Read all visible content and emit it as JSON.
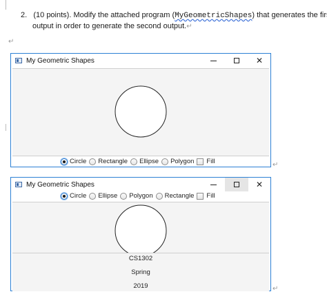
{
  "question": {
    "number": "2.",
    "line1_before": "(10 points). Modify the attached program (",
    "program_name": "MyGeometricShapes",
    "line1_after": ") that generates the first",
    "line2": "output in order to generate the second output.",
    "para_mark": "↵"
  },
  "window1": {
    "title": "My Geometric Shapes",
    "controls": {
      "minimize": "—",
      "maximize": "☐",
      "close": "✕"
    },
    "radios": [
      {
        "label": "Circle",
        "selected": true
      },
      {
        "label": "Rectangle",
        "selected": false
      },
      {
        "label": "Ellipse",
        "selected": false
      },
      {
        "label": "Polygon",
        "selected": false
      }
    ],
    "checkbox": {
      "label": "Fill",
      "checked": false
    }
  },
  "window2": {
    "title": "My Geometric Shapes",
    "controls": {
      "minimize": "—",
      "maximize": "☐",
      "close": "✕"
    },
    "radios": [
      {
        "label": "Circle",
        "selected": true
      },
      {
        "label": "Ellipse",
        "selected": false
      },
      {
        "label": "Polygon",
        "selected": false
      },
      {
        "label": "Rectangle",
        "selected": false
      }
    ],
    "checkbox": {
      "label": "Fill",
      "checked": false
    },
    "text_lines": [
      "CS1302",
      "Spring",
      "2019"
    ]
  }
}
